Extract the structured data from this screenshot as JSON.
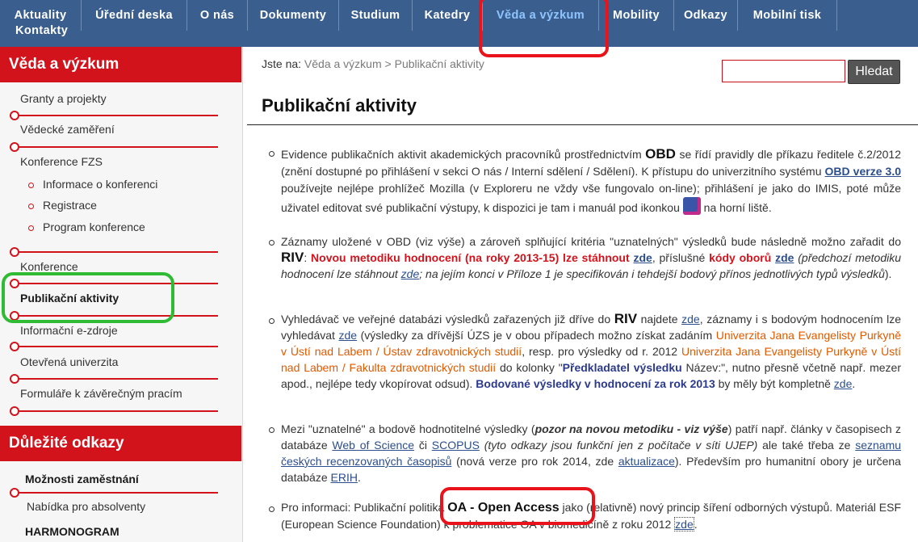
{
  "nav": {
    "items": [
      "Aktuality",
      "Úřední deska",
      "O nás",
      "Dokumenty",
      "Studium",
      "Katedry",
      "Věda a výzkum",
      "Mobility",
      "Odkazy",
      "Mobilní tisk"
    ],
    "second_row": "Kontakty",
    "active": "Věda a výzkum"
  },
  "sidebar": {
    "section_title": "Věda a výzkum",
    "items": [
      "Granty a projekty",
      "Vědecké zaměření",
      "Konference FZS"
    ],
    "sub_items": [
      "Informace o konferenci",
      "Registrace",
      "Program konference"
    ],
    "items2": [
      "Konference",
      "Publikační aktivity",
      "Informační e-zdroje",
      "Otevřená univerzita",
      "Formuláře k závěrečným pracím"
    ],
    "links_title": "Důležité odkazy",
    "links": [
      "Možnosti zaměstnání",
      "Nabídka pro absolventy",
      "HARMONOGRAM"
    ]
  },
  "breadcrumb": {
    "prefix": "Jste na:",
    "level1": "Věda a výzkum",
    "sep": ">",
    "level2": "Publikační aktivity"
  },
  "search": {
    "placeholder": "",
    "button": "Hledat"
  },
  "page_title": "Publikační aktivity",
  "p1": {
    "t1": "Evidence publikačních aktivit akademických pracovníků prostřednictvím ",
    "obd": "OBD",
    "t2": " se řídí pravidly dle příkazu ředitele č.2/2012 (znění dostupné po přihlášení v sekci O nás / Interní sdělení / Sdělení). K přístupu do univerzitního systému ",
    "link": "OBD verze 3.0",
    "t3": " používejte nejlépe prohlížeč Mozilla (v Exploreru ne vždy vše fungovalo on-line); přihlášení je jako do IMIS, poté může uživatel editovat své publikační výstupy, k dispozici je tam i manuál pod ikonkou ",
    "t4": " na horní liště."
  },
  "p2": {
    "t1": "Záznamy uložené v OBD (viz výše) a zároveň splňující kritéria \"uznatelných\" výsledků bude následně možno zařadit do ",
    "riv": "RIV",
    "colon": ": ",
    "red1": "Novou metodiku hodnocení (na roky 2013-15) lze stáhnout",
    "link1": "zde",
    "t2": ", příslušné ",
    "red2": "kódy oborů",
    "link2": "zde",
    "it1": " (předchozí metodiku hodnocení lze stáhnout ",
    "link3": "zde",
    "it2": "; na jejím konci v Příloze 1 je specifikován i tehdejší bodový přínos jednotlivých typů výsledků",
    "t3": ")."
  },
  "p3": {
    "t1": "Vyhledávač ve veřejné databázi výsledků zařazených již dříve do ",
    "riv": "RIV",
    "t2": " najdete ",
    "link1": "zde",
    "t3": ", záznamy i s bodovým hodnocením lze vyhledávat ",
    "link2": "zde",
    "t4": " (výsledky za dřívější ÚZS je v obou případech možno získat zadáním ",
    "o1": "Univerzita Jana Evangelisty Purkyně v Ústí nad Labem / Ústav zdravotnických studií",
    "t5": ", resp. pro výsledky od r. 2012 ",
    "o2": "Univerzita Jana Evangelisty Purkyně v Ústí nad Labem / Fakulta zdravotnických studií",
    "t6": " do kolonky \"",
    "pred": "Předkladatel výsledku",
    "t7": " Název:\", nutno přesně včetně např. mezer apod., nejlépe tedy vkopírovat odsud). ",
    "navy": "Bodované výsledky v hodnocení za rok 2013",
    "t8": " by měly být kompletně ",
    "link3": "zde",
    "t9": "."
  },
  "p4": {
    "t1": "Mezi \"uznatelné\" a bodově hodnotitelné výsledky (",
    "bi": "pozor na novou metodiku - viz výše",
    "t2": ") patří např. články v časopisech z databáze ",
    "link1": "Web of Science",
    "t3": " či ",
    "link2": "SCOPUS",
    "it1": " (tyto odkazy jsou funkční jen z počítače v síti UJEP)",
    "t4": " ale také třeba ze ",
    "link3": "seznamu českých recenzovaných časopisů",
    "t5": " (nová verze pro rok 2014, zde ",
    "link4": "aktualizace",
    "t6": "). Především pro humanitní obory je určena databáze ",
    "link5": "ERIH",
    "t7": "."
  },
  "p5": {
    "t1": "Pro informaci: Publikační politika ",
    "oa": "OA - Open Access",
    "t2": " jako (relativně) nový princip šíření odborných výstupů. Materiál ESF (European Science Foundation) k problematice OA v biomedicíně z roku 2012 ",
    "link": "zde",
    "t3": "."
  }
}
